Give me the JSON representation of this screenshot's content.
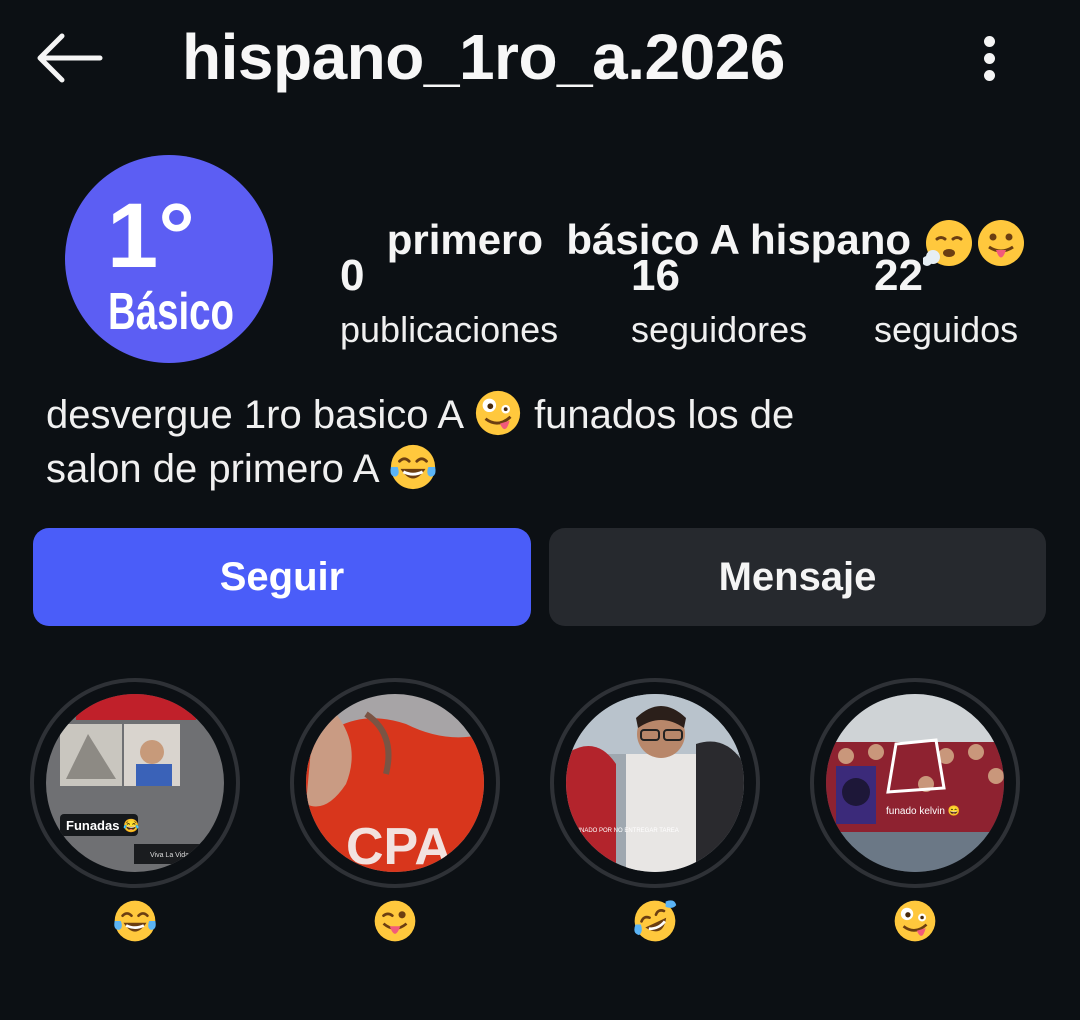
{
  "header": {
    "username": "hispano_1ro_a.2026",
    "back_icon": "arrow-left-icon",
    "more_icon": "vertical-dots-icon"
  },
  "profile": {
    "avatar_line1": "1°",
    "avatar_line2": "Básico",
    "display_name": "primero  básico A hispano ",
    "display_emojis": [
      "face-exhaling-emoji",
      "tongue-out-emoji"
    ],
    "stats": [
      {
        "value": "0",
        "label": "publicaciones"
      },
      {
        "value": "16",
        "label": "seguidores"
      },
      {
        "value": "22",
        "label": "seguidos"
      }
    ],
    "bio_part1": "desvergue 1ro basico A ",
    "bio_emoji1": "zany-face-emoji",
    "bio_part2": " funados los de",
    "bio_part3": "salon de primero A ",
    "bio_emoji2": "tears-of-joy-emoji"
  },
  "actions": {
    "follow_label": "Seguir",
    "message_label": "Mensaje"
  },
  "highlights": [
    {
      "emoji": "tears-of-joy-emoji",
      "caption": "Funadas 😂",
      "tag": "Viva La Vida (2024)"
    },
    {
      "emoji": "winking-tongue-emoji",
      "caption": "CPA"
    },
    {
      "emoji": "rolling-laughing-emoji",
      "caption": "FUNADO POR NO ENTREGAR TAREA"
    },
    {
      "emoji": "zany-face-emoji",
      "caption": "funado kelvin 😄"
    }
  ],
  "colors": {
    "background": "#0c1014",
    "follow_button": "#4a5df9",
    "message_button": "#26292e",
    "avatar": "#5c5ef3"
  }
}
